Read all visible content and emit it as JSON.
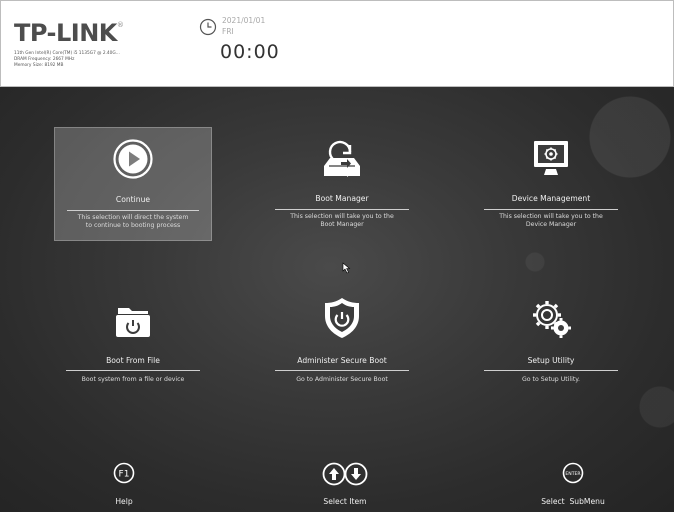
{
  "header": {
    "brand": "TP-LINK",
    "brand_mark": "®",
    "cpu_line": "11th Gen Intel(R) Core(TM) i5 1135G7 @ 2.40G...",
    "dram_line": "DRAM Frequency: 2667 MHz",
    "memory_line": "Memory Size: 8192 MB",
    "date": "2021/01/01",
    "weekday": "FRI",
    "time": "00:00"
  },
  "tiles": [
    {
      "label": "Continue",
      "desc1": "This selection will direct the system",
      "desc2": "to continue to booting process",
      "icon": "play-icon",
      "selected": true
    },
    {
      "label": "Boot Manager",
      "desc1": "This selection will take you to the",
      "desc2": "Boot Manager",
      "icon": "boot-manager-icon"
    },
    {
      "label": "Device Management",
      "desc1": "This selection will take you to the",
      "desc2": "Device Manager",
      "icon": "monitor-gear-icon"
    },
    {
      "label": "Boot From File",
      "desc1": "Boot system from a file or device",
      "icon": "folder-power-icon"
    },
    {
      "label": "Administer Secure Boot",
      "desc1": "Go to Administer Secure Boot",
      "icon": "shield-power-icon"
    },
    {
      "label": "Setup Utility",
      "desc1": "Go to Setup Utility.",
      "icon": "gears-icon"
    }
  ],
  "footer": [
    {
      "key": "F1",
      "label": "Help",
      "icon": "f1-key-icon"
    },
    {
      "label": "Select Item",
      "icon": "up-down-arrows-icon"
    },
    {
      "key": "ENTER",
      "label": "Select  SubMenu",
      "icon": "enter-key-icon"
    }
  ],
  "colors": {
    "header_bg": "#ffffff",
    "main_bg": "#2c2c2c",
    "text": "#f0f0f0",
    "selected_tile": "#7a7a7a"
  }
}
